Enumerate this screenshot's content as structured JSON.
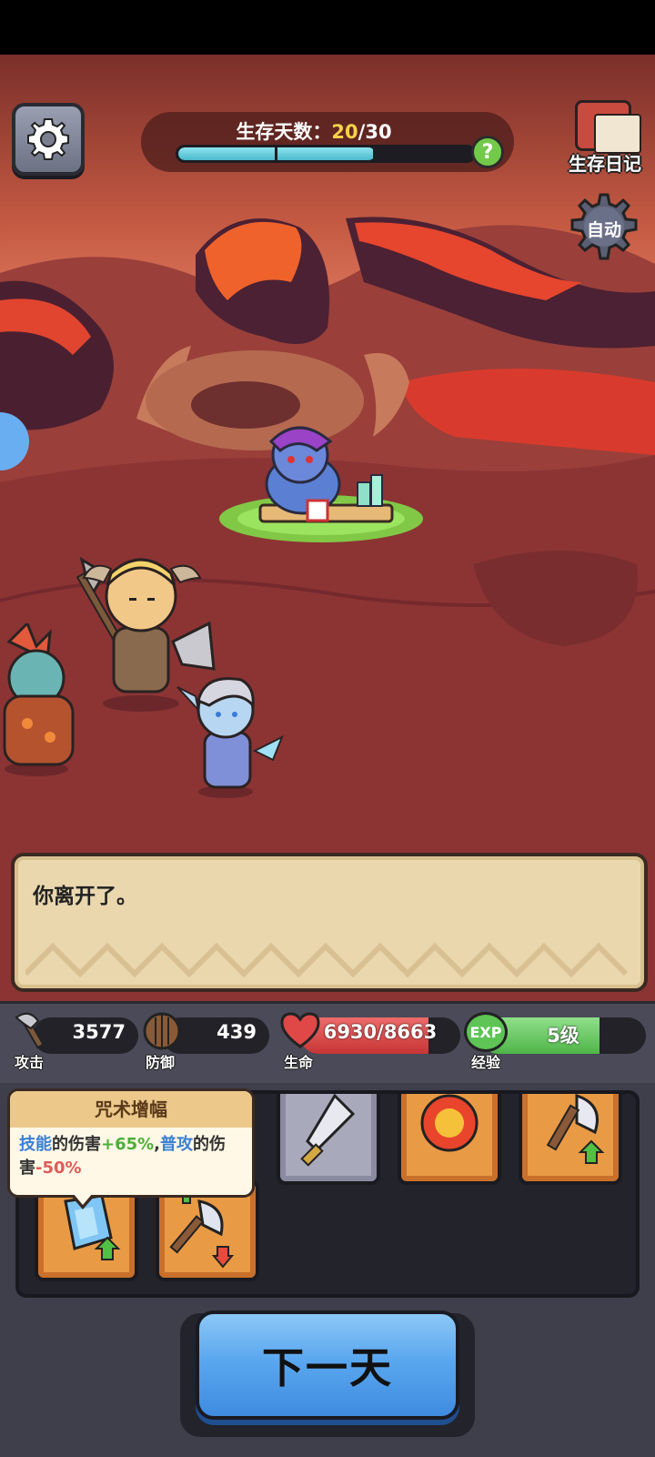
{
  "hud": {
    "days_label": "生存天数：",
    "days_current": "20",
    "days_sep": "/30",
    "days_progress": 0.667,
    "help_label": "?",
    "diary_label": "生存日记",
    "auto_label": "自动"
  },
  "dialog": {
    "message": "你离开了。"
  },
  "stats": {
    "attack": {
      "value": "3577",
      "label": "攻击"
    },
    "defense": {
      "value": "439",
      "label": "防御"
    },
    "hp": {
      "value": "6930/8663",
      "label": "生命",
      "fraction": 0.8
    },
    "exp": {
      "value": "5级",
      "label": "经验",
      "badge": "EXP",
      "fraction": 0.72
    }
  },
  "tooltip": {
    "title": "咒术增幅",
    "skill_word": "技能",
    "text1": "的伤害",
    "plus": "+65%",
    "comma": ",",
    "attack_word": "普攻",
    "text2": "的伤害",
    "minus": "-50%"
  },
  "next_day": {
    "label": "下一天"
  },
  "colors": {
    "accent_blue": "#5aa7ef",
    "hp_red": "#e04848",
    "exp_green": "#5dc455",
    "days_yellow": "#f6d24a"
  }
}
